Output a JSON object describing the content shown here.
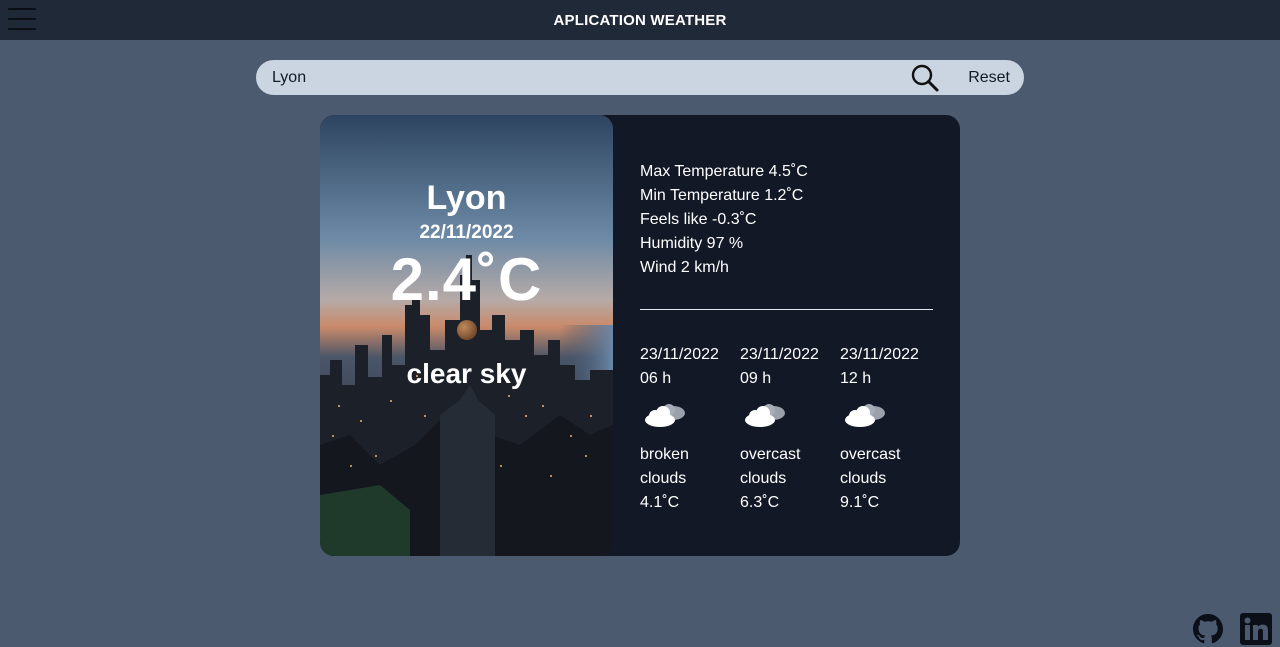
{
  "header": {
    "title": "APLICATION WEATHER",
    "menu_icon": "hamburger-menu-icon"
  },
  "search": {
    "value": "Lyon",
    "placeholder": "",
    "search_icon": "search-icon",
    "reset_label": "Reset"
  },
  "current": {
    "city": "Lyon",
    "date": "22/11/2022",
    "temperature": "2.4˚C",
    "description": "clear sky",
    "icon": "moon-icon"
  },
  "details": [
    "Max Temperature 4.5˚C",
    "Min Temperature 1.2˚C",
    "Feels like -0.3˚C",
    "Humidity 97 %",
    "Wind 2 km/h"
  ],
  "forecast": [
    {
      "date": "23/11/2022",
      "hour": "06 h",
      "icon": "cloud-icon",
      "desc1": "broken",
      "desc2": "clouds",
      "temp": "4.1˚C"
    },
    {
      "date": "23/11/2022",
      "hour": "09 h",
      "icon": "cloud-icon",
      "desc1": "overcast",
      "desc2": "clouds",
      "temp": "6.3˚C"
    },
    {
      "date": "23/11/2022",
      "hour": "12 h",
      "icon": "cloud-icon",
      "desc1": "overcast",
      "desc2": "clouds",
      "temp": "9.1˚C"
    }
  ],
  "footer": {
    "icons": [
      "github-icon",
      "linkedin-icon"
    ]
  },
  "colors": {
    "background": "#4b5a6e",
    "topbar": "#1f2937",
    "card": "#121826",
    "search_bar": "#cbd5e1",
    "text": "#ffffff"
  }
}
